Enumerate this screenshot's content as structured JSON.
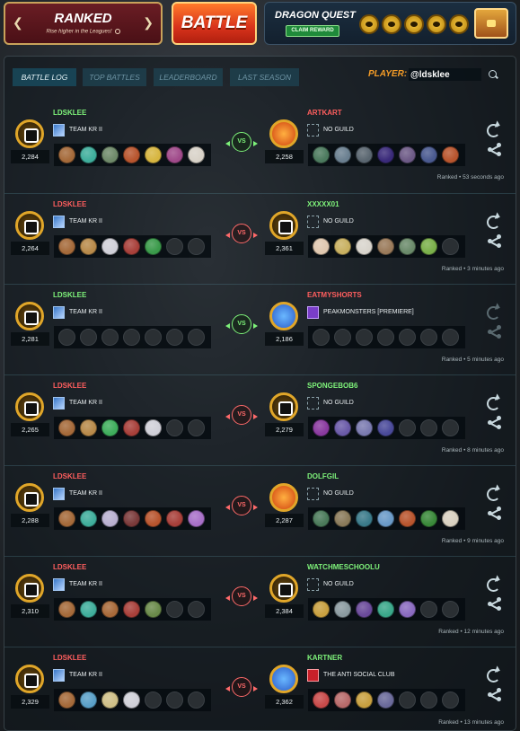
{
  "header": {
    "ranked": {
      "title": "RANKED",
      "subtitle": "Rise higher in the Leagues!"
    },
    "battle_label": "BATTLE",
    "quest": {
      "title": "DRAGON QUEST",
      "claim_label": "CLAIM REWARD",
      "coin_count": 5
    }
  },
  "tabs": [
    {
      "label": "BATTLE LOG",
      "active": true
    },
    {
      "label": "TOP BATTLES",
      "active": false
    },
    {
      "label": "LEADERBOARD",
      "active": false
    },
    {
      "label": "LAST SEASON",
      "active": false
    }
  ],
  "player": {
    "label": "PLAYER:",
    "value": "@ldsklee"
  },
  "colors": {
    "win": "#7ef27a",
    "lose": "#ff5e5e",
    "accent": "#f39b27"
  },
  "battles": [
    {
      "result": "win",
      "vs_label": "VS",
      "left": {
        "name": "LDSKLEE",
        "rating": "2,284",
        "guild": "TEAM KR II",
        "guild_type": "team",
        "badge": "gold",
        "cards": [
          "#a56a3a",
          "#3fae9c",
          "#6f8a6a",
          "#b8552e",
          "#d7b640",
          "#a04a8a",
          "#d8d2c8"
        ]
      },
      "right": {
        "name": "ARTKART",
        "rating": "2,258",
        "guild": "NO GUILD",
        "guild_type": "none",
        "badge": "fire",
        "cards": [
          "#4c7a5e",
          "#6a7f90",
          "#5a6670",
          "#3a2a7a",
          "#6d5a86",
          "#4a5a90",
          "#b8552e"
        ]
      },
      "time": "Ranked • 53 seconds ago",
      "replay_enabled": true
    },
    {
      "result": "lose",
      "vs_label": "VS",
      "left": {
        "name": "LDSKLEE",
        "rating": "2,264",
        "guild": "TEAM KR II",
        "guild_type": "team",
        "badge": "gold",
        "cards": [
          "#a56a3a",
          "#b88a4a",
          "#d0d0d8",
          "#a8403a",
          "#3a9a4a",
          "empty",
          "empty"
        ]
      },
      "right": {
        "name": "XXXXX01",
        "rating": "2,361",
        "guild": "NO GUILD",
        "guild_type": "none",
        "badge": "gold",
        "cards": [
          "#e0c8b0",
          "#c8b060",
          "#d8d4cc",
          "#9a7a5a",
          "#6a8a6a",
          "#7ab04a",
          "empty"
        ]
      },
      "time": "Ranked • 3 minutes ago",
      "replay_enabled": true
    },
    {
      "result": "win",
      "vs_label": "VS",
      "left": {
        "name": "LDSKLEE",
        "rating": "2,281",
        "guild": "TEAM KR II",
        "guild_type": "team",
        "badge": "gold",
        "cards": [
          "empty",
          "empty",
          "empty",
          "empty",
          "empty",
          "empty",
          "empty"
        ]
      },
      "right": {
        "name": "EATMYSHORTS",
        "rating": "2,186",
        "guild": "PEAKMONSTERS [PREMIERE]",
        "guild_type": "peak",
        "badge": "blue",
        "cards": [
          "empty",
          "empty",
          "empty",
          "empty",
          "empty",
          "empty",
          "empty"
        ]
      },
      "time": "Ranked • 5 minutes ago",
      "replay_enabled": false
    },
    {
      "result": "lose",
      "vs_label": "VS",
      "left": {
        "name": "LDSKLEE",
        "rating": "2,265",
        "guild": "TEAM KR II",
        "guild_type": "team",
        "badge": "gold",
        "cards": [
          "#a56a3a",
          "#b88a4a",
          "#3fae5c",
          "#a8403a",
          "#d0d0d8",
          "empty",
          "empty"
        ]
      },
      "right": {
        "name": "SPONGEBOB6",
        "rating": "2,279",
        "guild": "NO GUILD",
        "guild_type": "none",
        "badge": "gold",
        "cards": [
          "#8a3aa0",
          "#6a5aa8",
          "#7a7ab0",
          "#4a4a9a",
          "empty",
          "empty",
          "empty"
        ]
      },
      "time": "Ranked • 8 minutes ago",
      "replay_enabled": true
    },
    {
      "result": "lose",
      "vs_label": "VS",
      "left": {
        "name": "LDSKLEE",
        "rating": "2,288",
        "guild": "TEAM KR II",
        "guild_type": "team",
        "badge": "gold",
        "cards": [
          "#a56a3a",
          "#3fae9c",
          "#b8b0d0",
          "#7a3a3a",
          "#b8552e",
          "#a8403a",
          "#a870c8"
        ]
      },
      "right": {
        "name": "DOLFGIL",
        "rating": "2,287",
        "guild": "NO GUILD",
        "guild_type": "none",
        "badge": "fire",
        "cards": [
          "#4a7a5a",
          "#8a7a5a",
          "#3a7a8a",
          "#6a9ac8",
          "#b8552e",
          "#3a8a3a",
          "#d8d0c0"
        ]
      },
      "time": "Ranked • 9 minutes ago",
      "replay_enabled": true
    },
    {
      "result": "lose",
      "vs_label": "VS",
      "left": {
        "name": "LDSKLEE",
        "rating": "2,310",
        "guild": "TEAM KR II",
        "guild_type": "team",
        "badge": "gold",
        "cards": [
          "#a56a3a",
          "#3fae9c",
          "#a86a3a",
          "#a8403a",
          "#6a8a4a",
          "empty",
          "empty"
        ]
      },
      "right": {
        "name": "WATCHMESCHOOLU",
        "rating": "2,384",
        "guild": "NO GUILD",
        "guild_type": "none",
        "badge": "gold",
        "cards": [
          "#c8a040",
          "#8a9aa0",
          "#6a4a9a",
          "#3aa88a",
          "#8a6ac0",
          "empty",
          "empty"
        ]
      },
      "time": "Ranked • 12 minutes ago",
      "replay_enabled": true
    },
    {
      "result": "lose",
      "vs_label": "VS",
      "left": {
        "name": "LDSKLEE",
        "rating": "2,329",
        "guild": "TEAM KR II",
        "guild_type": "team",
        "badge": "gold",
        "cards": [
          "#a56a3a",
          "#5aa0c8",
          "#d0c088",
          "#d0d0d8",
          "empty",
          "empty",
          "empty"
        ]
      },
      "right": {
        "name": "KARTNER",
        "rating": "2,362",
        "guild": "THE ANTI SOCIAL CLUB",
        "guild_type": "anti",
        "badge": "blue",
        "cards": [
          "#c84a4a",
          "#b86a6a",
          "#c8a040",
          "#6a6a9a",
          "empty",
          "empty",
          "empty"
        ]
      },
      "time": "Ranked • 13 minutes ago",
      "replay_enabled": true
    }
  ]
}
